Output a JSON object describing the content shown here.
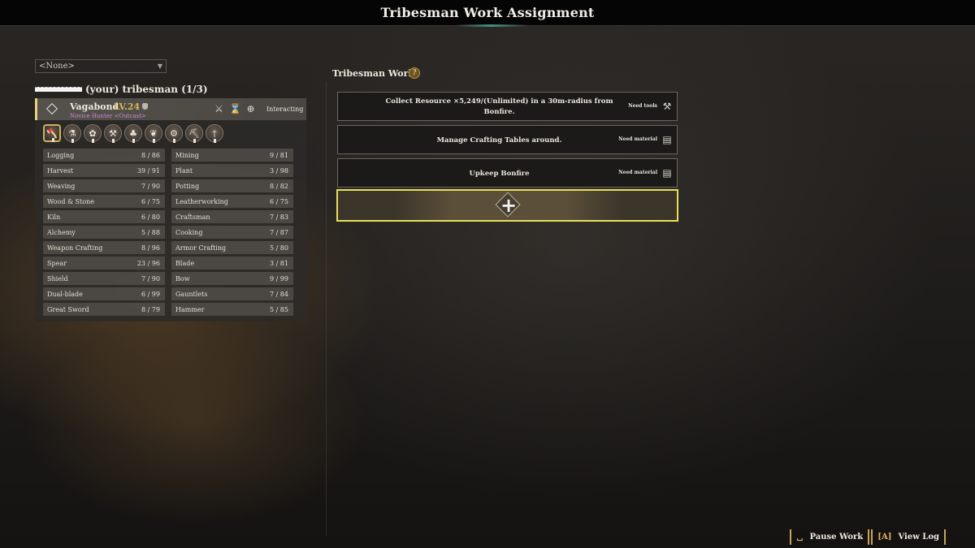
{
  "header": {
    "title": "Tribesman Work Assignment"
  },
  "filter": {
    "selected": "<None>"
  },
  "tribe": {
    "label": "(your) tribesman (1/3)"
  },
  "tribesman": {
    "name": "Vagabond",
    "level": "LV.24",
    "title": "Novice Hunter <Outcast>",
    "status": "Interacting",
    "skill_icons": [
      "axe-icon",
      "potion-icon",
      "cogs-icon",
      "hammer-icon",
      "plant-icon",
      "herb-icon",
      "gear-craft-icon",
      "pickaxe-icon",
      "blade-icon"
    ]
  },
  "stats": [
    {
      "label": "Logging",
      "value": "8 / 86"
    },
    {
      "label": "Mining",
      "value": "9 / 81"
    },
    {
      "label": "Harvest",
      "value": "39 / 91"
    },
    {
      "label": "Plant",
      "value": "3 / 98"
    },
    {
      "label": "Weaving",
      "value": "7 / 90"
    },
    {
      "label": "Potting",
      "value": "8 / 82"
    },
    {
      "label": "Wood & Stone",
      "value": "6 / 75"
    },
    {
      "label": "Leatherworking",
      "value": "6 / 75"
    },
    {
      "label": "Kiln",
      "value": "6 / 80"
    },
    {
      "label": "Craftsman",
      "value": "7 / 83"
    },
    {
      "label": "Alchemy",
      "value": "5 / 88"
    },
    {
      "label": "Cooking",
      "value": "7 / 87"
    },
    {
      "label": "Weapon Crafting",
      "value": "8 / 96"
    },
    {
      "label": "Armor Crafting",
      "value": "5 / 80"
    },
    {
      "label": "Spear",
      "value": "23 / 96"
    },
    {
      "label": "Blade",
      "value": "3 / 81"
    },
    {
      "label": "Shield",
      "value": "7 / 90"
    },
    {
      "label": "Bow",
      "value": "9 / 99"
    },
    {
      "label": "Dual-blade",
      "value": "6 / 99"
    },
    {
      "label": "Gauntlets",
      "value": "7 / 84"
    },
    {
      "label": "Great Sword",
      "value": "8 / 79"
    },
    {
      "label": "Hammer",
      "value": "5 / 85"
    }
  ],
  "work": {
    "title": "Tribesman Work",
    "help_glyph": "?",
    "slots": [
      {
        "text_line1": "Collect Resource ×5,249/(Unlimited) in a 30m-radius from",
        "text_line2": "Bonfire.",
        "requirement": "Need tools",
        "icon": "tools-icon"
      },
      {
        "text_line1": "Manage Crafting Tables around.",
        "text_line2": "",
        "requirement": "Need material",
        "icon": "material-icon"
      },
      {
        "text_line1": "Upkeep Bonfire",
        "text_line2": "",
        "requirement": "Need material",
        "icon": "material-icon"
      }
    ],
    "add_glyph": "+"
  },
  "controls": {
    "pause": {
      "key": "␣",
      "label": "Pause Work"
    },
    "log": {
      "key": "[A]",
      "label": "View Log"
    }
  },
  "colors": {
    "accent": "#e6e15a",
    "level": "#d8b65a",
    "subtitle": "#c58bd6"
  }
}
